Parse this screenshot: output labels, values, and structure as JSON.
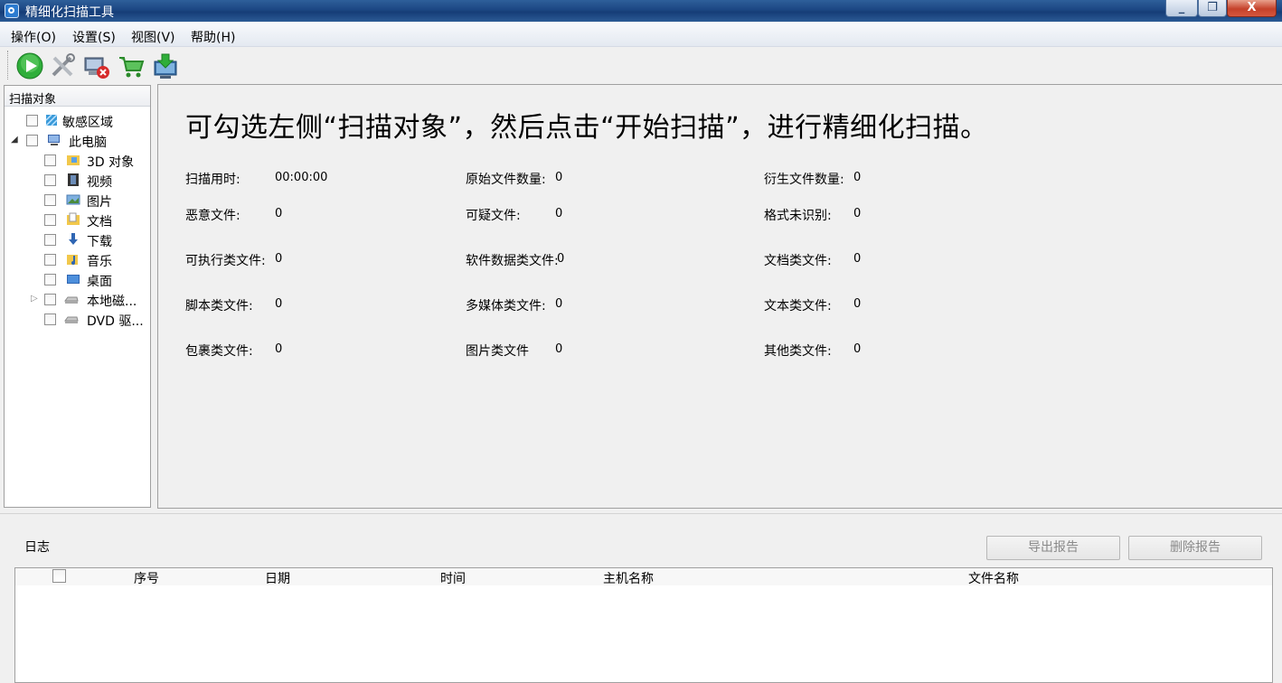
{
  "window": {
    "title": "精细化扫描工具",
    "close_glyph": "X",
    "min_glyph": "_",
    "max_glyph": "❐"
  },
  "menu": [
    {
      "label": "操作(O)"
    },
    {
      "label": "设置(S)"
    },
    {
      "label": "视图(V)"
    },
    {
      "label": "帮助(H)"
    }
  ],
  "toolbar": {
    "icons": [
      "play-icon",
      "tools-icon",
      "remove-computer-icon",
      "cart-icon",
      "download-icon"
    ]
  },
  "sidebar": {
    "header": "扫描对象",
    "items": [
      {
        "label": "敏感区域",
        "icon": "sensitive-area-icon"
      },
      {
        "label": "此电脑",
        "icon": "computer-icon"
      },
      {
        "label": "3D 对象",
        "icon": "3d-folder-icon"
      },
      {
        "label": "视频",
        "icon": "video-icon"
      },
      {
        "label": "图片",
        "icon": "picture-icon"
      },
      {
        "label": "文档",
        "icon": "document-icon"
      },
      {
        "label": "下载",
        "icon": "download-arrow-icon"
      },
      {
        "label": "音乐",
        "icon": "music-icon"
      },
      {
        "label": "桌面",
        "icon": "desktop-icon"
      },
      {
        "label": "本地磁...",
        "icon": "disk-icon"
      },
      {
        "label": "DVD 驱...",
        "icon": "dvd-icon"
      }
    ]
  },
  "main": {
    "headline": "可勾选左侧“扫描对象”，然后点击“开始扫描”，进行精细化扫描。",
    "stats": [
      {
        "label": "扫描用时:",
        "value": "00:00:00"
      },
      {
        "label": "原始文件数量:",
        "value": "0"
      },
      {
        "label": "衍生文件数量:",
        "value": "0"
      },
      {
        "label": "恶意文件:",
        "value": "0"
      },
      {
        "label": "可疑文件:",
        "value": "0"
      },
      {
        "label": "格式未识别:",
        "value": "0"
      },
      {
        "label": "可执行类文件:",
        "value": "0"
      },
      {
        "label": "软件数据类文件:",
        "value": "0"
      },
      {
        "label": "文档类文件:",
        "value": "0"
      },
      {
        "label": "脚本类文件:",
        "value": "0"
      },
      {
        "label": "多媒体类文件:",
        "value": "0"
      },
      {
        "label": "文本类文件:",
        "value": "0"
      },
      {
        "label": "包裹类文件:",
        "value": "0"
      },
      {
        "label": "图片类文件",
        "value": "0"
      },
      {
        "label": "其他类文件:",
        "value": "0"
      }
    ]
  },
  "log": {
    "title": "日志",
    "export_button": "导出报告",
    "delete_button": "删除报告",
    "columns": [
      "序号",
      "日期",
      "时间",
      "主机名称",
      "文件名称"
    ]
  },
  "colors": {
    "accent": "#1c4683",
    "close": "#c5412a",
    "panel_border": "#a0a0a0"
  }
}
